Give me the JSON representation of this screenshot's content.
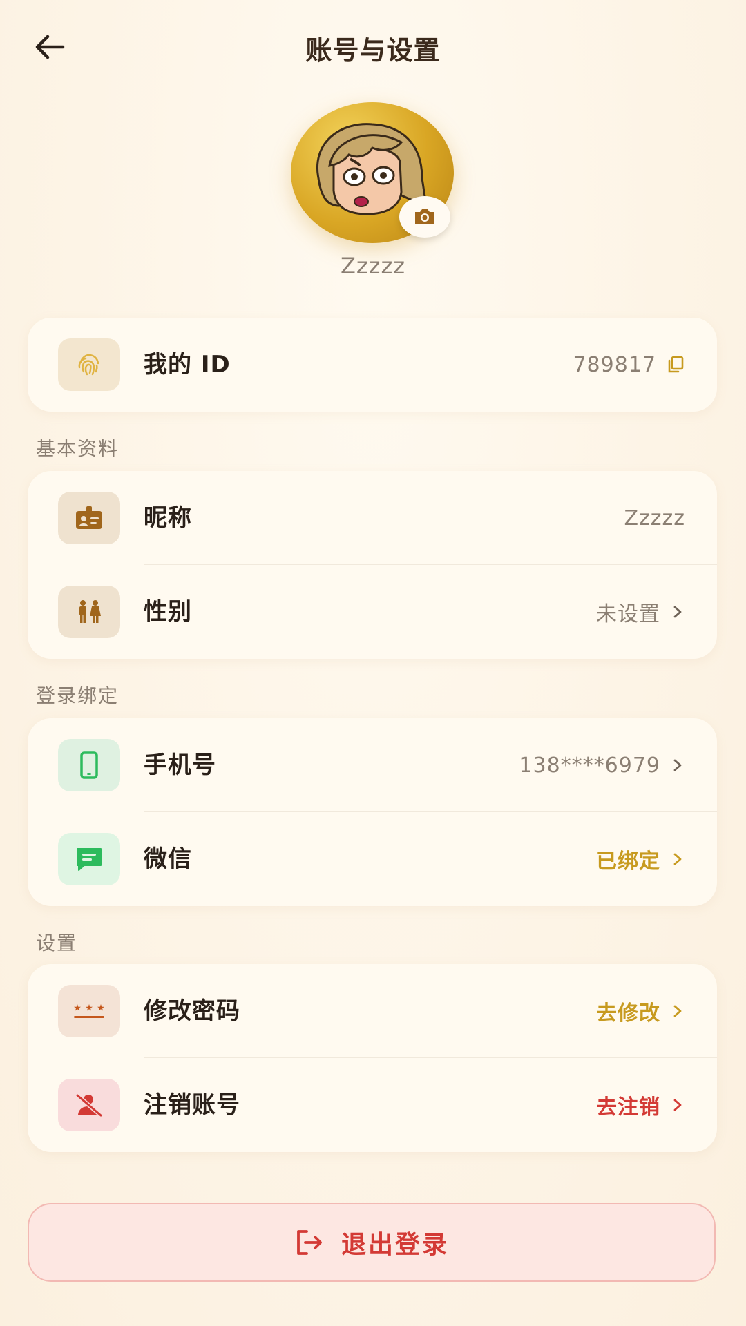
{
  "header": {
    "title": "账号与设置"
  },
  "profile": {
    "nickname": "Zzzzz"
  },
  "id_card": {
    "label": "我的 ID",
    "value": "789817"
  },
  "sections": {
    "basic": "基本资料",
    "login": "登录绑定",
    "settings": "设置"
  },
  "basic_rows": {
    "nickname": {
      "label": "昵称",
      "value": "Zzzzz"
    },
    "gender": {
      "label": "性别",
      "value": "未设置"
    }
  },
  "login_rows": {
    "phone": {
      "label": "手机号",
      "value": "138****6979"
    },
    "wechat": {
      "label": "微信",
      "value": "已绑定"
    }
  },
  "settings_rows": {
    "password": {
      "label": "修改密码",
      "value": "去修改"
    },
    "cancel": {
      "label": "注销账号",
      "value": "去注销"
    }
  },
  "logout": {
    "label": "退出登录"
  },
  "colors": {
    "accent_gold": "#c79a1f",
    "danger_red": "#d33a35",
    "wechat_green": "#2dbb5d",
    "brown_icon": "#a0661c"
  },
  "icons": {
    "back": "arrow-left-icon",
    "camera": "camera-icon",
    "id": "fingerprint-icon",
    "nickname": "id-badge-icon",
    "gender": "gender-icon",
    "phone": "phone-icon",
    "wechat": "chat-icon",
    "password": "password-icon",
    "cancel": "user-remove-icon",
    "copy": "copy-icon",
    "logout": "logout-icon"
  }
}
